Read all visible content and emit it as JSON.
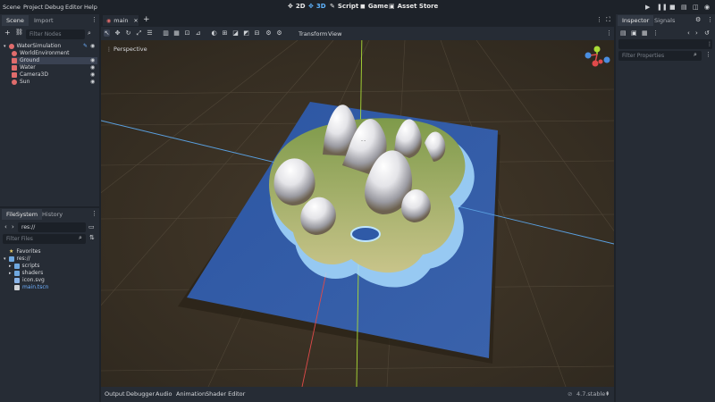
{
  "menu": [
    "Scene",
    "Project",
    "Debug",
    "Editor",
    "Help"
  ],
  "workspaces": [
    {
      "label": "2D",
      "icon": "2d-icon",
      "active": false
    },
    {
      "label": "3D",
      "icon": "3d-icon",
      "active": true
    },
    {
      "label": "Script",
      "icon": "script-icon",
      "active": false
    },
    {
      "label": "Game",
      "icon": "game-icon",
      "active": false
    },
    {
      "label": "Asset Store",
      "icon": "asset-store-icon",
      "active": false
    }
  ],
  "scene_dock": {
    "tabs": [
      "Scene",
      "Import"
    ],
    "filter_placeholder": "Filter Nodes",
    "nodes": [
      {
        "label": "WaterSimulation",
        "color": "#e06c6c",
        "selected": false
      },
      {
        "label": "WorldEnvironment",
        "color": "#e06c6c",
        "selected": false
      },
      {
        "label": "Ground",
        "color": "#e06c6c",
        "selected": true
      },
      {
        "label": "Water",
        "color": "#e06c6c",
        "selected": false
      },
      {
        "label": "Camera3D",
        "color": "#e06c6c",
        "selected": false
      },
      {
        "label": "Sun",
        "color": "#e06c6c",
        "selected": false
      }
    ]
  },
  "filesystem_dock": {
    "tabs": [
      "FileSystem",
      "History"
    ],
    "path": "res://",
    "filter_placeholder": "Filter Files",
    "items": [
      {
        "label": "Favorites",
        "icon": "star-icon",
        "color": "#d6d8dc"
      },
      {
        "label": "res://",
        "icon": "folder-icon",
        "color": "#d6d8dc"
      },
      {
        "label": "scripts",
        "icon": "folder-icon",
        "color": "#d6d8dc"
      },
      {
        "label": "shaders",
        "icon": "folder-icon",
        "color": "#d6d8dc"
      },
      {
        "label": "icon.svg",
        "icon": "image-icon",
        "color": "#d6d8dc"
      },
      {
        "label": "main.tscn",
        "icon": "scene-file-icon",
        "color": "#6fb0ff"
      }
    ]
  },
  "editor_tab": {
    "label": "main"
  },
  "viewport": {
    "toolbar_menus": [
      "Transform",
      "View"
    ],
    "perspective_label": "Perspective"
  },
  "inspector": {
    "tabs": [
      "Inspector",
      "Signals"
    ],
    "filter_placeholder": "Filter Properties"
  },
  "bottom_tabs": [
    "Output",
    "Debugger",
    "Audio",
    "Animation",
    "Shader Editor"
  ],
  "version": "4.7.stable",
  "colors": {
    "accent": "#5fb4ff",
    "panel": "#262c35",
    "background": "#1d2229"
  }
}
